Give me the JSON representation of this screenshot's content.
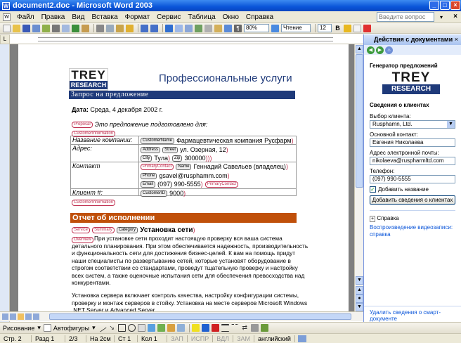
{
  "window": {
    "title": "document2.doc - Microsoft Word 2003"
  },
  "menu": {
    "items": [
      "Файл",
      "Правка",
      "Вид",
      "Вставка",
      "Формат",
      "Сервис",
      "Таблица",
      "Окно",
      "Справка"
    ],
    "help_placeholder": "Введите вопрос"
  },
  "toolbar": {
    "zoom": "80%",
    "read_label": "Чтение",
    "font_size": "12"
  },
  "document": {
    "logo_top": "TREY",
    "logo_bottom": "RESEARCH",
    "header_title": "Профессиональные услуги",
    "proposal_bar": "Запрос на предложение",
    "date_label": "Дата:",
    "date_value": "Среда, 4 декабря 2002 г.",
    "prepared_for": "Это предложение подготовлено для:",
    "tags": {
      "proposal": "Proposal",
      "customer_information": "CustomerInformation",
      "customer_name": "CustomerName",
      "address": "Address",
      "street": "Street",
      "city": "City",
      "zip": "Zip",
      "primary_contact": "PrimaryContact",
      "name": "Name",
      "phone": "Phone",
      "email": "Email",
      "customer_id": "CustomerID",
      "service": "Service",
      "summary": "Summary",
      "category": "Category",
      "overview": "Overview"
    },
    "table": {
      "company_label": "Название компании:",
      "company_value": "Фармацевтическая компания Русфарм",
      "address_label": "Адрес:",
      "street_value": "ул. Озерная, 12",
      "city_value": "Тула",
      "zip_value": "300000",
      "contact_label": "Контакт",
      "contact_name": "Геннадий Савельев (владелец)",
      "email_value": "gsavel@rusphamm.com",
      "phone_value": "(097) 990-5555",
      "client_label": "Клиент #:",
      "client_value": "9000"
    },
    "section_title": "Отчет об исполнении",
    "service_title": "Установка сети",
    "paragraph1": "При установке сети проходит настоящую проверку вся ваша система детального планирования. При этом обеспечивается надежность, производительность и функциональность сети для достижения бизнес-целей. К вам на помощь придут наши специалисты по развертыванию сетей, которые установят оборудование в строгом соответствии со стандартами, проведут тщательную проверку и настройку всех систем, а также оценочные испытания сети для обеспечения превосходства над конкурентами.",
    "paragraph2": "Установка сервера включает контроль качества, настройку конфигурации системы, проверку и монтаж серверов в стойку. Установка на месте серверов Microsoft Windows .NET Server и Advanced Server"
  },
  "task_pane": {
    "title": "Действия с документами",
    "generator_title": "Генератор предложений",
    "logo_top": "TREY",
    "logo_bottom": "RESEARCH",
    "client_info_title": "Сведения о клиентах",
    "select_client_label": "Выбор клиента:",
    "select_client_value": "Rusphamn, Ltd.",
    "main_contact_label": "Основной контакт:",
    "main_contact_value": "Евгения Николаева",
    "email_label": "Адрес электронной почты:",
    "email_value": "nikolaeva@ruspharmltd.com",
    "phone_label": "Телефон:",
    "phone_value": "(097) 990-5555",
    "add_checkbox_label": "Добавить название",
    "add_button": "Добавить сведения о клиентах",
    "help_label": "Справка",
    "help_link": "Воспроизведение видеозаписи: справка",
    "footer_link": "Удалить сведения о смарт-документе"
  },
  "drawing_toolbar": {
    "draw_label": "Рисование",
    "autoshapes_label": "Автофигуры"
  },
  "status_bar": {
    "page": "Стр. 2",
    "section": "Разд 1",
    "pages": "2/3",
    "position": "На 2см",
    "line": "Ст 1",
    "column": "Кол 1",
    "rec": "ЗАП",
    "trk": "ИСПР",
    "ext": "ВДЛ",
    "ovr": "ЗАМ",
    "language": "английский"
  },
  "colors": {
    "accent_orange": "#c0500a",
    "brand_blue": "#1f3a7a",
    "title_blue": "#0a55d9",
    "tag_red": "#c03050"
  }
}
